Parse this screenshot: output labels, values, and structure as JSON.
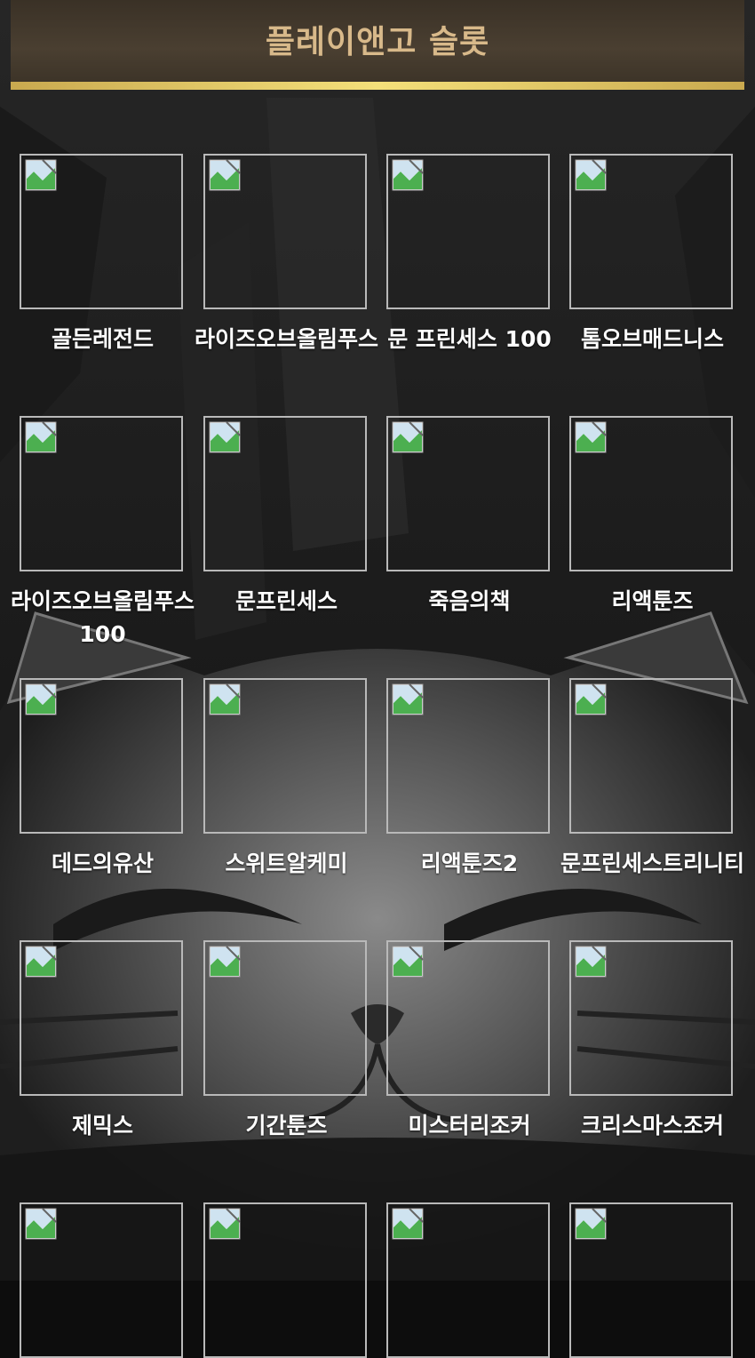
{
  "header": {
    "title": "플레이앤고 슬롯"
  },
  "games": [
    {
      "name": "골든레전드"
    },
    {
      "name": "라이즈오브올림푸스"
    },
    {
      "name": "문 프린세스 100"
    },
    {
      "name": "톰오브매드니스"
    },
    {
      "name": "라이즈오브올림푸스100"
    },
    {
      "name": "문프린세스"
    },
    {
      "name": "죽음의책"
    },
    {
      "name": "리액툰즈"
    },
    {
      "name": "데드의유산"
    },
    {
      "name": "스위트알케미"
    },
    {
      "name": "리액툰즈2"
    },
    {
      "name": "문프린세스트리니티"
    },
    {
      "name": "제믹스"
    },
    {
      "name": "기간툰즈"
    },
    {
      "name": "미스터리조커"
    },
    {
      "name": "크리스마스조커"
    },
    {
      "name": ""
    },
    {
      "name": ""
    },
    {
      "name": ""
    },
    {
      "name": ""
    }
  ],
  "colors": {
    "header_bg": "#45392c",
    "header_text": "#d8b98a",
    "accent_bar": "#f4e07a",
    "tile_border": "#b9b9b9"
  },
  "icons": {
    "thumbnail": "broken-image-icon"
  }
}
